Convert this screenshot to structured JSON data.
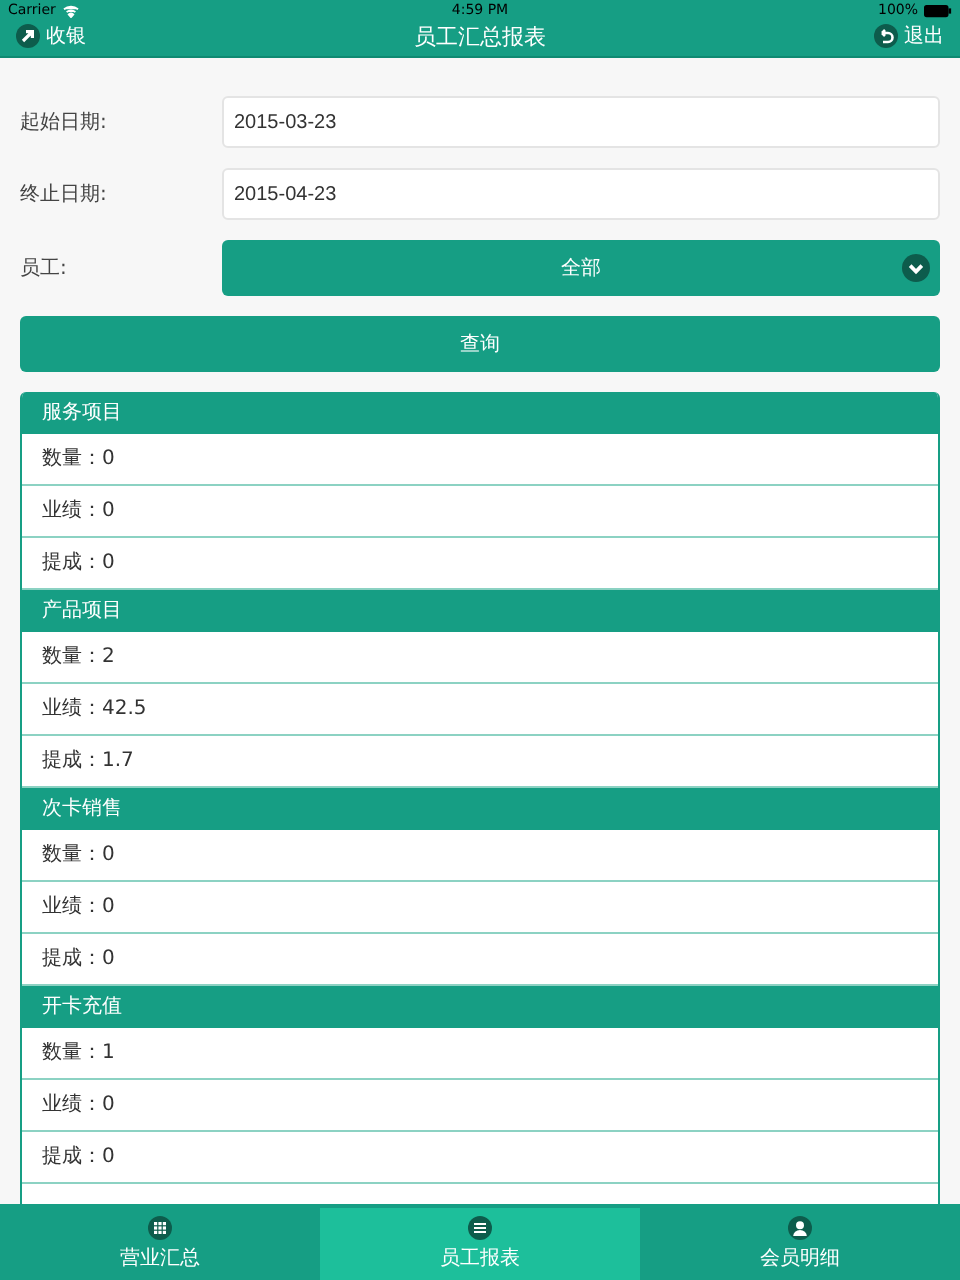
{
  "status_bar": {
    "carrier": "Carrier",
    "time": "4:59 PM",
    "battery": "100%"
  },
  "nav": {
    "left": "收银",
    "title": "员工汇总报表",
    "right": "退出"
  },
  "form": {
    "fields": [
      {
        "label": "起始日期:",
        "value": "2015-03-23"
      },
      {
        "label": "终止日期:",
        "value": "2015-04-23"
      }
    ],
    "employee": {
      "label": "员工:",
      "value": "全部"
    },
    "query_button": "查询"
  },
  "sections": [
    {
      "title": "服务项目",
      "rows": [
        "数量：0",
        "业绩：0",
        "提成：0"
      ]
    },
    {
      "title": "产品项目",
      "rows": [
        "数量：2",
        "业绩：42.5",
        "提成：1.7"
      ]
    },
    {
      "title": "次卡销售",
      "rows": [
        "数量：0",
        "业绩：0",
        "提成：0"
      ]
    },
    {
      "title": "开卡充值",
      "rows": [
        "数量：1",
        "业绩：0",
        "提成：0"
      ]
    }
  ],
  "tabs": [
    {
      "label": "营业汇总",
      "kind": "grid",
      "selected": false
    },
    {
      "label": "员工报表",
      "kind": "list",
      "selected": true
    },
    {
      "label": "会员明细",
      "kind": "person",
      "selected": false
    }
  ]
}
